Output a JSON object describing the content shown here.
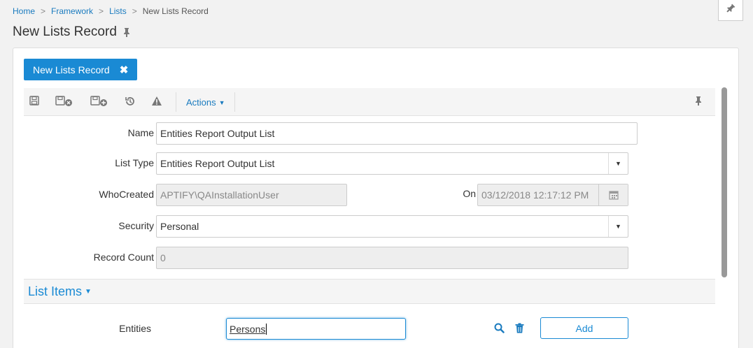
{
  "breadcrumb": {
    "items": [
      "Home",
      "Framework",
      "Lists",
      "New Lists Record"
    ],
    "separator": ">"
  },
  "page": {
    "title": "New Lists Record"
  },
  "record_tab": {
    "label": "New Lists Record"
  },
  "toolbar": {
    "actions_label": "Actions"
  },
  "form": {
    "name": {
      "label": "Name",
      "value": "Entities Report Output List"
    },
    "list_type": {
      "label": "List Type",
      "value": "Entities Report Output List"
    },
    "who_created": {
      "label": "WhoCreated",
      "value": "APTIFY\\QAInstallationUser"
    },
    "on": {
      "label": "On",
      "value": "03/12/2018 12:17:12 PM"
    },
    "security": {
      "label": "Security",
      "value": "Personal"
    },
    "record_count": {
      "label": "Record Count",
      "value": "0"
    }
  },
  "list_items": {
    "title": "List Items",
    "entities_label": "Entities",
    "entities_value": "Persons",
    "add_label": "Add"
  },
  "colors": {
    "accent": "#1a8ad4",
    "link": "#1a7bbf"
  }
}
